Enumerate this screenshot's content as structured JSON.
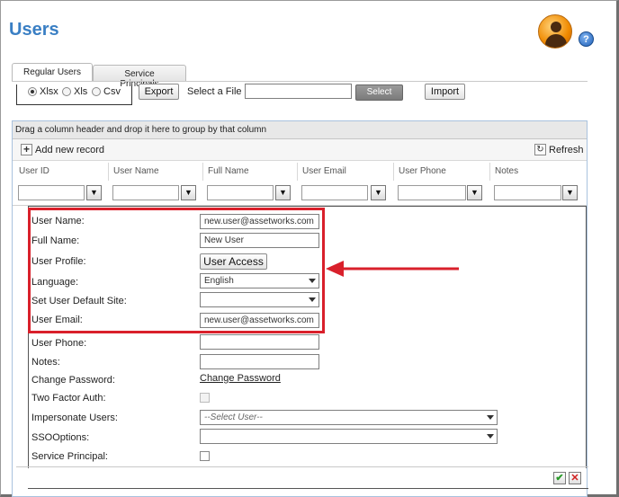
{
  "page": {
    "title": "Users"
  },
  "colors": {
    "accent": "#3a7fc4",
    "highlight": "#d9202b"
  },
  "tabs": [
    {
      "label": "Regular Users",
      "active": true
    },
    {
      "label": "Service Principals",
      "active": false
    }
  ],
  "export": {
    "formats": [
      {
        "label": "Xlsx",
        "selected": true
      },
      {
        "label": "Xls",
        "selected": false
      },
      {
        "label": "Csv",
        "selected": false
      }
    ],
    "export_label": "Export",
    "select_file_label": "Select a File :",
    "file_value": "",
    "select_label": "Select",
    "import_label": "Import"
  },
  "grid": {
    "group_hint": "Drag a column header and drop it here to group by that column",
    "add_record_label": "Add new record",
    "refresh_label": "Refresh",
    "columns": [
      "User ID",
      "User Name",
      "Full Name",
      "User Email",
      "User Phone",
      "Notes"
    ],
    "filter_icon": "filter-icon"
  },
  "form": {
    "user_name": {
      "label": "User Name:",
      "value": "new.user@assetworks.com"
    },
    "full_name": {
      "label": "Full Name:",
      "value": "New User"
    },
    "user_profile": {
      "label": "User Profile:",
      "button_label": "User Access"
    },
    "language": {
      "label": "Language:",
      "value": "English"
    },
    "default_site": {
      "label": "Set User Default Site:",
      "value": ""
    },
    "user_email": {
      "label": "User Email:",
      "value": "new.user@assetworks.com"
    },
    "user_phone": {
      "label": "User Phone:",
      "value": ""
    },
    "notes": {
      "label": "Notes:",
      "value": ""
    },
    "change_password": {
      "label": "Change Password:",
      "link_label": "Change Password"
    },
    "two_factor": {
      "label": "Two Factor Auth:",
      "checked": false
    },
    "impersonate": {
      "label": "Impersonate Users:",
      "value": "--Select User--"
    },
    "sso": {
      "label": "SSOOptions:",
      "value": ""
    },
    "service_principal": {
      "label": "Service Principal:",
      "checked": false
    }
  },
  "actions": {
    "ok_icon": "check-icon",
    "cancel_icon": "cancel-x-icon"
  }
}
